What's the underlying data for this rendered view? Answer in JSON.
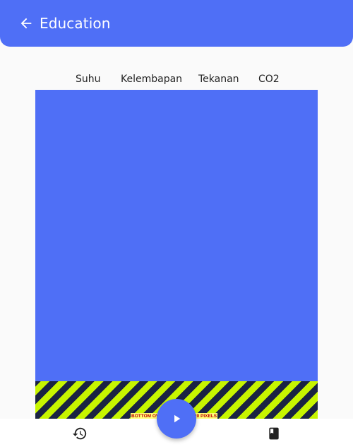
{
  "appbar": {
    "title": "Education",
    "back_icon": "arrow-back-icon",
    "color": "#4f6ff6"
  },
  "tabs": [
    {
      "label": "Suhu"
    },
    {
      "label": "Kelembapan"
    },
    {
      "label": "Tekanan"
    },
    {
      "label": "CO2"
    }
  ],
  "content": {
    "panel_color": "#4f6ff6"
  },
  "overflow_warning": {
    "text": "BOTTOM OVERFLOWED BY 20 PIXELS"
  },
  "fab": {
    "icon": "play-icon"
  },
  "bottom_nav": {
    "items": [
      {
        "icon": "history-icon"
      },
      {
        "icon": "book-icon"
      }
    ]
  }
}
